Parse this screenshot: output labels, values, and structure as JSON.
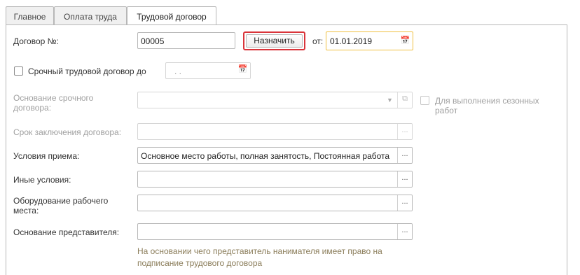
{
  "tabs": [
    {
      "label": "Главное"
    },
    {
      "label": "Оплата труда"
    },
    {
      "label": "Трудовой договор"
    }
  ],
  "contract": {
    "number_label": "Договор №:",
    "number_value": "00005",
    "assign_label": "Назначить",
    "from_label": "от:",
    "date_value": "01.01.2019"
  },
  "fixed_term": {
    "label": "Срочный трудовой договор до",
    "date_placeholder": " .  .    "
  },
  "basis": {
    "label": "Основание срочного договора:",
    "seasonal_label": "Для выполнения сезонных работ"
  },
  "term": {
    "label": "Срок заключения договора:"
  },
  "hiring_conditions": {
    "label": "Условия приема:",
    "value": "Основное место работы, полная занятость, Постоянная работа"
  },
  "other_conditions": {
    "label": "Иные условия:",
    "value": ""
  },
  "workplace": {
    "label": "Оборудование рабочего места:",
    "value": ""
  },
  "representative": {
    "label": "Основание представителя:",
    "value": "",
    "hint": "На основании чего представитель нанимателя имеет право на подписание трудового договора"
  },
  "icons": {
    "calendar": "calendar-icon",
    "ellipsis": "ellipsis-icon",
    "dropdown": "chevron-down-icon",
    "open": "open-icon"
  }
}
